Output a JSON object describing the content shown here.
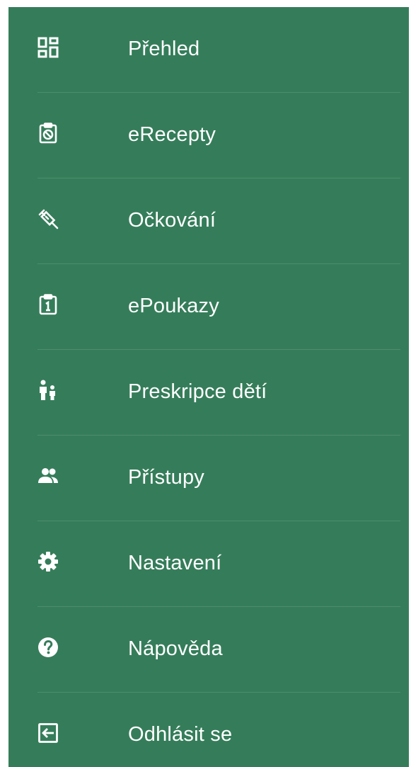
{
  "menu": {
    "items": [
      {
        "label": "Přehled",
        "icon": "dashboard-icon"
      },
      {
        "label": "eRecepty",
        "icon": "prescription-clipboard-icon"
      },
      {
        "label": "Očkování",
        "icon": "syringe-icon"
      },
      {
        "label": "ePoukazy",
        "icon": "voucher-clipboard-icon"
      },
      {
        "label": "Preskripce dětí",
        "icon": "parent-child-icon"
      },
      {
        "label": "Přístupy",
        "icon": "people-icon"
      },
      {
        "label": "Nastavení",
        "icon": "gear-icon"
      },
      {
        "label": "Nápověda",
        "icon": "help-icon"
      },
      {
        "label": "Odhlásit se",
        "icon": "logout-icon"
      }
    ]
  },
  "colors": {
    "drawer_background": "#357d5a",
    "text": "#ffffff",
    "icon": "#ffffff"
  }
}
